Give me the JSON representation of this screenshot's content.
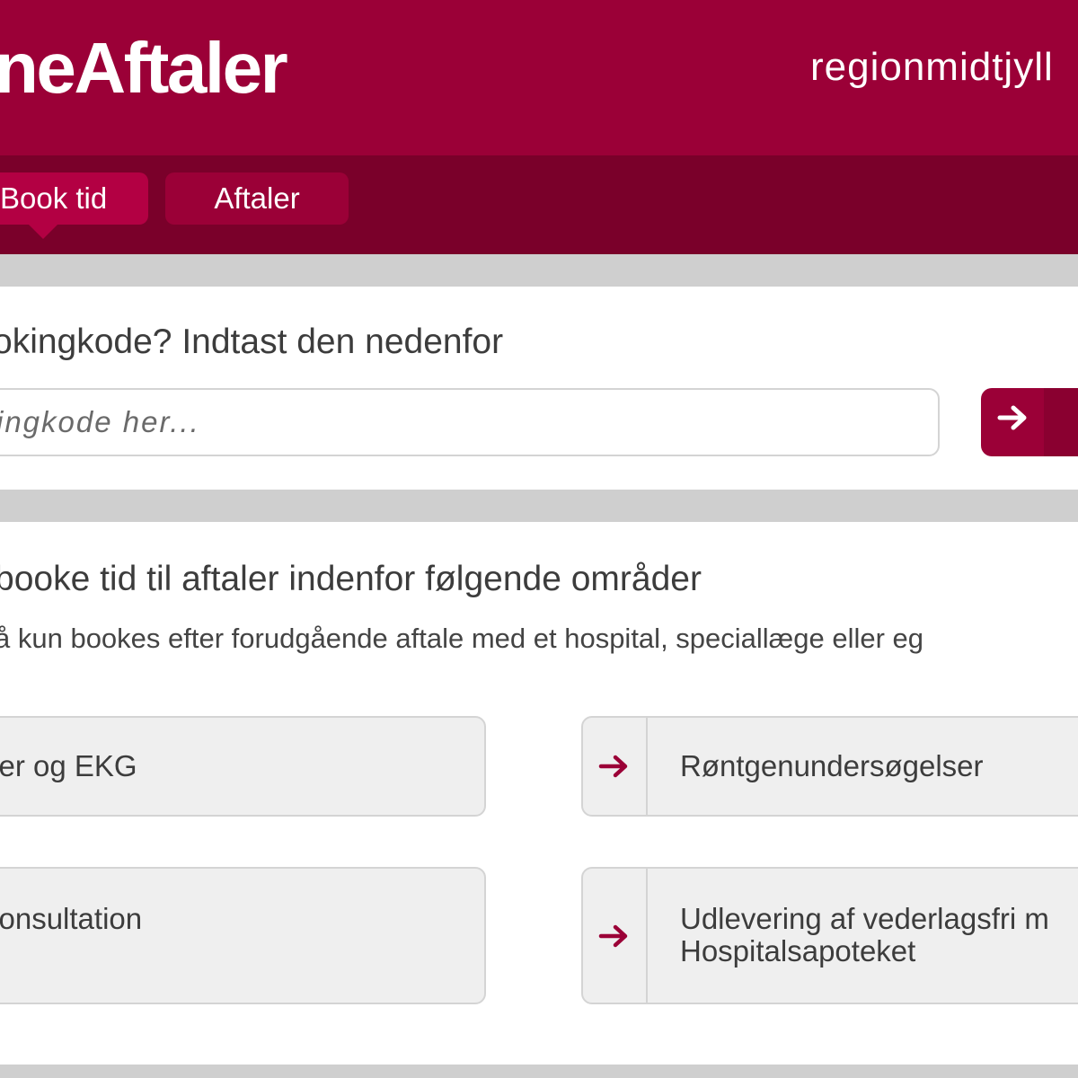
{
  "header": {
    "logo_text": "neAftaler",
    "region_text": "regionmidtjyll"
  },
  "nav": {
    "tabs": [
      {
        "label": "Book tid",
        "active": true
      },
      {
        "label": "Aftaler",
        "active": false
      }
    ]
  },
  "code_section": {
    "heading": "okingkode? Indtast den nedenfor",
    "input_placeholder": "ingkode her...",
    "input_value": ""
  },
  "areas_section": {
    "heading": "booke tid til aftaler indenfor følgende områder",
    "subtext": "å kun bookes efter forudgående aftale med et hospital, speciallæge eller eg"
  },
  "cards": [
    {
      "label": "ver og EKG"
    },
    {
      "label": "Røntgenundersøgelser"
    },
    {
      "label": "konsultation"
    },
    {
      "label_line1": "Udlevering af vederlagsfri m",
      "label_line2": "Hospitalsapoteket"
    }
  ],
  "colors": {
    "brand": "#9b0037",
    "brand_dark": "#7a002a",
    "tab_active": "#b30043",
    "card_bg": "#efefef",
    "separator": "#cfcfcf"
  },
  "icons": {
    "submit": "arrow-right-icon",
    "card": "arrow-right-icon"
  }
}
